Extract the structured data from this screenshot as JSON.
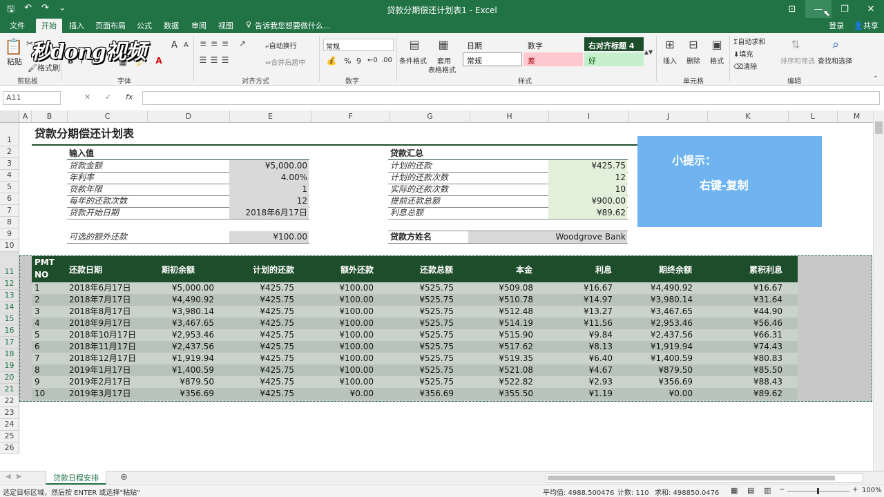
{
  "window": {
    "title": "贷款分期偿还计划表1 - Excel",
    "buttons": [
      "⊡",
      "—",
      "❐",
      "✕"
    ]
  },
  "menu": {
    "tabs": [
      "文件",
      "开始",
      "插入",
      "页面布局",
      "公式",
      "数据",
      "审阅",
      "视图"
    ],
    "tell_me": "告诉我您想要做什么...",
    "login": "登录",
    "share": "共享"
  },
  "ribbon": {
    "paste": "粘贴",
    "format_painter": "格式刷",
    "clipboard": "剪贴板",
    "font_group": "字体",
    "font_size_up": "A",
    "font_size_down": "A",
    "bold": "B",
    "italic": "I",
    "underline": "U",
    "align_group": "对齐方式",
    "wrap": "自动换行",
    "merge": "合并后居中",
    "number_format": "常规",
    "number_group": "数字",
    "percent": "%",
    "comma": "9",
    "cond_format": "条件格式",
    "table_format_1": "套用",
    "table_format_2": "表格格式",
    "styles": {
      "date": "日期",
      "number": "数字",
      "heading": "右对齐标题 4",
      "normal": "常规",
      "bad": "差",
      "good": "好"
    },
    "styles_group": "样式",
    "insert": "插入",
    "delete": "删除",
    "format": "格式",
    "cells_group": "单元格",
    "autosum": "自动求和",
    "fill": "填充",
    "clear": "清除",
    "sort": "排序和筛选",
    "find": "查找和选择",
    "edit_group": "编辑",
    "logo": "秒dong视频"
  },
  "formula": {
    "namebox": "A11",
    "cancel": "✕",
    "confirm": "✓",
    "fx": "fx"
  },
  "columns": [
    "A",
    "B",
    "C",
    "D",
    "E",
    "F",
    "G",
    "H",
    "I",
    "J",
    "K",
    "L",
    "M"
  ],
  "rows": [
    "1",
    "2",
    "3",
    "4",
    "5",
    "6",
    "7",
    "8",
    "9",
    "10",
    "11",
    "12",
    "13",
    "14",
    "15",
    "16",
    "17",
    "18",
    "19",
    "20",
    "21",
    "22",
    "23",
    "24",
    "25",
    "26"
  ],
  "sheet": {
    "title": "贷款分期偿还计划表",
    "input_header": "输入值",
    "inputs": [
      {
        "label": "贷款金额",
        "value": "¥5,000.00"
      },
      {
        "label": "年利率",
        "value": "4.00%"
      },
      {
        "label": "贷款年限",
        "value": "1"
      },
      {
        "label": "每年的还款次数",
        "value": "12"
      },
      {
        "label": "贷款开始日期",
        "value": "2018年6月17日"
      }
    ],
    "extra_label": "可选的额外还款",
    "extra_value": "¥100.00",
    "summary_header": "贷款汇总",
    "summary": [
      {
        "label": "计划的还款",
        "value": "¥425.75"
      },
      {
        "label": "计划的还款次数",
        "value": "12"
      },
      {
        "label": "实际的还款次数",
        "value": "10"
      },
      {
        "label": "提前还款总额",
        "value": "¥900.00"
      },
      {
        "label": "利息总额",
        "value": "¥89.62"
      }
    ],
    "lender_label": "贷款方姓名",
    "lender_value": "Woodgrove Bank",
    "tip_line1": "小提示：",
    "tip_line2": "右键-复制"
  },
  "schedule": {
    "headers": [
      "PMT",
      "NO",
      "还款日期",
      "期初余额",
      "计划的还款",
      "额外还款",
      "还款总额",
      "本金",
      "利息",
      "期终余额",
      "累积利息"
    ],
    "rows": [
      [
        "1",
        "2018年6月17日",
        "¥5,000.00",
        "¥425.75",
        "¥100.00",
        "¥525.75",
        "¥509.08",
        "¥16.67",
        "¥4,490.92",
        "¥16.67"
      ],
      [
        "2",
        "2018年7月17日",
        "¥4,490.92",
        "¥425.75",
        "¥100.00",
        "¥525.75",
        "¥510.78",
        "¥14.97",
        "¥3,980.14",
        "¥31.64"
      ],
      [
        "3",
        "2018年8月17日",
        "¥3,980.14",
        "¥425.75",
        "¥100.00",
        "¥525.75",
        "¥512.48",
        "¥13.27",
        "¥3,467.65",
        "¥44.90"
      ],
      [
        "4",
        "2018年9月17日",
        "¥3,467.65",
        "¥425.75",
        "¥100.00",
        "¥525.75",
        "¥514.19",
        "¥11.56",
        "¥2,953.46",
        "¥56.46"
      ],
      [
        "5",
        "2018年10月17日",
        "¥2,953.46",
        "¥425.75",
        "¥100.00",
        "¥525.75",
        "¥515.90",
        "¥9.84",
        "¥2,437.56",
        "¥66.31"
      ],
      [
        "6",
        "2018年11月17日",
        "¥2,437.56",
        "¥425.75",
        "¥100.00",
        "¥525.75",
        "¥517.62",
        "¥8.13",
        "¥1,919.94",
        "¥74.43"
      ],
      [
        "7",
        "2018年12月17日",
        "¥1,919.94",
        "¥425.75",
        "¥100.00",
        "¥525.75",
        "¥519.35",
        "¥6.40",
        "¥1,400.59",
        "¥80.83"
      ],
      [
        "8",
        "2019年1月17日",
        "¥1,400.59",
        "¥425.75",
        "¥100.00",
        "¥525.75",
        "¥521.08",
        "¥4.67",
        "¥879.50",
        "¥85.50"
      ],
      [
        "9",
        "2019年2月17日",
        "¥879.50",
        "¥425.75",
        "¥100.00",
        "¥525.75",
        "¥522.82",
        "¥2.93",
        "¥356.69",
        "¥88.43"
      ],
      [
        "10",
        "2019年3月17日",
        "¥356.69",
        "¥425.75",
        "¥0.00",
        "¥356.69",
        "¥355.50",
        "¥1.19",
        "¥0.00",
        "¥89.62"
      ]
    ]
  },
  "tabs": {
    "sheet_name": "贷款日程安排",
    "add": "⊕"
  },
  "status": {
    "message": "选定目标区域，然后按 ENTER 或选择\"粘贴\"",
    "average": "平均值: 4988.500476",
    "count": "计数: 110",
    "sum": "求和: 498850.0476",
    "zoom": "100%"
  },
  "colors": {
    "excel_green": "#217346",
    "header_dark": "#1e4d2b",
    "tip_blue": "#6fb4f0"
  }
}
